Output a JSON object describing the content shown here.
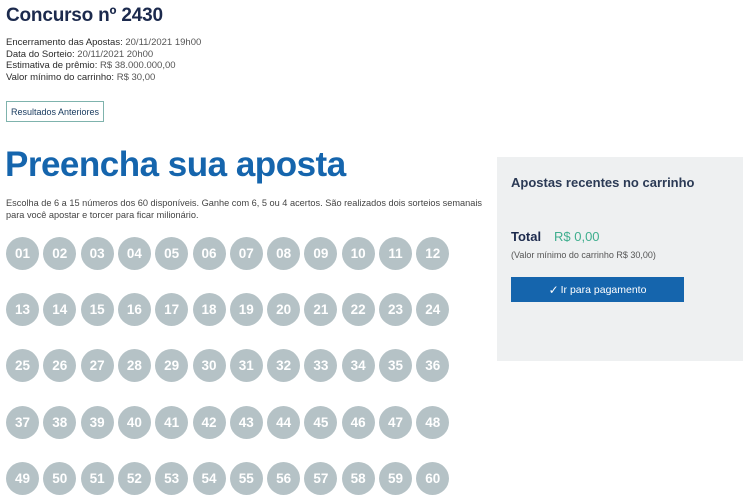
{
  "contest": {
    "title": "Concurso nº 2430",
    "info": [
      {
        "label": "Encerramento das Apostas:",
        "value": "20/11/2021 19h00"
      },
      {
        "label": "Data do Sorteio:",
        "value": "20/11/2021 20h00"
      },
      {
        "label": "Estimativa de prêmio:",
        "value": "R$ 38.000.000,00"
      },
      {
        "label": "Valor mínimo do carrinho:",
        "value": "R$ 30,00"
      }
    ],
    "previous_results_label": "Resultados Anteriores"
  },
  "bet": {
    "headline": "Preencha sua aposta",
    "description": "Escolha de 6 a 15 números dos 60 disponíveis. Ganhe com 6, 5 ou 4 acertos. São realizados dois sorteios semanais para você apostar e torcer para ficar milionário.",
    "numbers": [
      "01",
      "02",
      "03",
      "04",
      "05",
      "06",
      "07",
      "08",
      "09",
      "10",
      "11",
      "12",
      "13",
      "14",
      "15",
      "16",
      "17",
      "18",
      "19",
      "20",
      "21",
      "22",
      "23",
      "24",
      "25",
      "26",
      "27",
      "28",
      "29",
      "30",
      "31",
      "32",
      "33",
      "34",
      "35",
      "36",
      "37",
      "38",
      "39",
      "40",
      "41",
      "42",
      "43",
      "44",
      "45",
      "46",
      "47",
      "48",
      "49",
      "50",
      "51",
      "52",
      "53",
      "54",
      "55",
      "56",
      "57",
      "58",
      "59",
      "60"
    ]
  },
  "cart": {
    "title": "Apostas recentes no carrinho",
    "total_label": "Total",
    "total_value": "R$ 0,00",
    "min_note": "(Valor mínimo do carrinho R$ 30,00)",
    "pay_button": "Ir para pagamento",
    "pay_icon": "check-icon"
  },
  "colors": {
    "headline": "#1565ad",
    "ball": "#b5c2c6",
    "total_value": "#3fae8e",
    "pay_button": "#1565ad"
  }
}
